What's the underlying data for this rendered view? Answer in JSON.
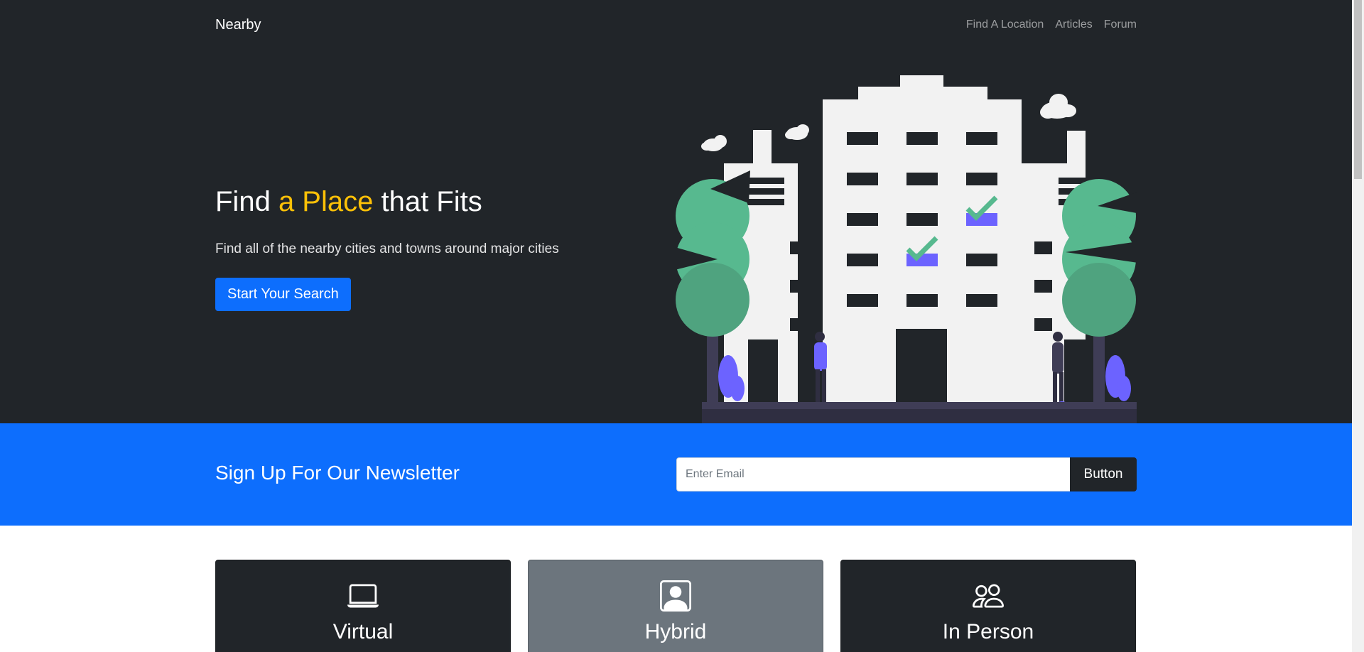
{
  "header": {
    "brand": "Nearby",
    "nav": [
      "Find A Location",
      "Articles",
      "Forum"
    ]
  },
  "hero": {
    "title_part1": "Find ",
    "title_accent": "a Place",
    "title_part2": " that Fits",
    "subtitle": "Find all of the nearby cities and towns around major cities",
    "cta_label": "Start Your Search"
  },
  "newsletter": {
    "title": "Sign Up For Our Newsletter",
    "email_placeholder": "Enter Email",
    "button_label": "Button"
  },
  "cards": [
    {
      "label": "Virtual",
      "icon": "laptop-icon"
    },
    {
      "label": "Hybrid",
      "icon": "person-square-icon"
    },
    {
      "label": "In Person",
      "icon": "people-icon"
    }
  ],
  "colors": {
    "dark": "#212529",
    "primary": "#0d6efd",
    "accent": "#ffc107",
    "secondary": "#6c757d",
    "tree_green": "#57b98f",
    "illustration_purple": "#6c63ff"
  }
}
